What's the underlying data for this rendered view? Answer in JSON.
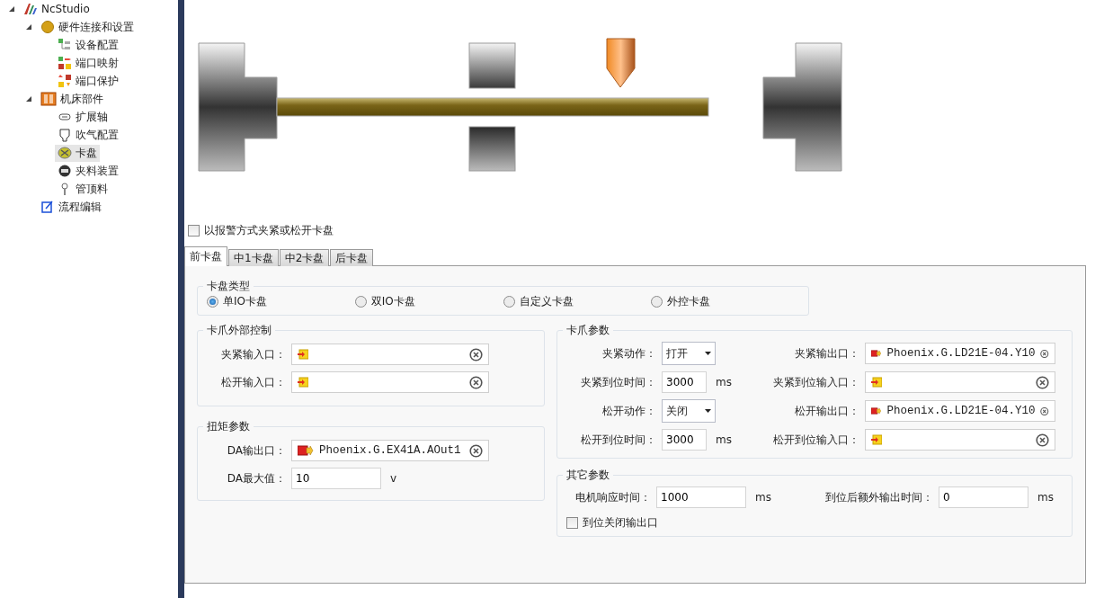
{
  "sidebar": {
    "tree": [
      {
        "label": "NcStudio",
        "expanded": true,
        "selected": false,
        "children": [
          {
            "label": "硬件连接和设置",
            "expanded": true,
            "selected": false,
            "children": [
              {
                "label": "设备配置",
                "selected": false
              },
              {
                "label": "端口映射",
                "selected": false
              },
              {
                "label": "端口保护",
                "selected": false
              }
            ]
          },
          {
            "label": "机床部件",
            "expanded": true,
            "selected": false,
            "children": [
              {
                "label": "扩展轴",
                "selected": false
              },
              {
                "label": "吹气配置",
                "selected": false
              },
              {
                "label": "卡盘",
                "selected": true
              },
              {
                "label": "夹料装置",
                "selected": false
              },
              {
                "label": "管顶料",
                "selected": false
              }
            ]
          },
          {
            "label": "流程编辑",
            "selected": false
          }
        ]
      }
    ]
  },
  "alarm_checkbox": {
    "label": "以报警方式夹紧或松开卡盘",
    "checked": false
  },
  "tabs": [
    {
      "label": "前卡盘",
      "selected": true
    },
    {
      "label": "中1卡盘",
      "selected": false
    },
    {
      "label": "中2卡盘",
      "selected": false
    },
    {
      "label": "后卡盘",
      "selected": false
    }
  ],
  "chuck_type": {
    "title": "卡盘类型",
    "options": [
      {
        "label": "单IO卡盘",
        "selected": true
      },
      {
        "label": "双IO卡盘",
        "selected": false
      },
      {
        "label": "自定义卡盘",
        "selected": false
      },
      {
        "label": "外控卡盘",
        "selected": false
      }
    ]
  },
  "external_control": {
    "title": "卡爪外部控制",
    "fields": [
      {
        "kind": "input_port",
        "label": "夹紧输入口："
      },
      {
        "kind": "input_port",
        "label": "松开输入口："
      }
    ]
  },
  "torque": {
    "title": "扭矩参数",
    "fields": [
      {
        "kind": "output_port",
        "label": "DA输出口：",
        "value": "Phoenix.G.EX41A.AOut1"
      },
      {
        "kind": "number",
        "label": "DA最大值：",
        "value": "10",
        "unit": "v"
      }
    ]
  },
  "claw_params": {
    "title": "卡爪参数",
    "fields": [
      {
        "kind": "select",
        "label": "夹紧动作：",
        "value": "打开"
      },
      {
        "kind": "output_port",
        "label": "夹紧输出口：",
        "value": "Phoenix.G.LD21E-04.Y10"
      },
      {
        "kind": "number",
        "label": "夹紧到位时间：",
        "value": "3000",
        "unit": "ms"
      },
      {
        "kind": "input_port",
        "label": "夹紧到位输入口："
      },
      {
        "kind": "select",
        "label": "松开动作：",
        "value": "关闭"
      },
      {
        "kind": "output_port",
        "label": "松开输出口：",
        "value": "Phoenix.G.LD21E-04.Y10"
      },
      {
        "kind": "number",
        "label": "松开到位时间：",
        "value": "3000",
        "unit": "ms"
      },
      {
        "kind": "input_port",
        "label": "松开到位输入口："
      }
    ]
  },
  "other_params": {
    "title": "其它参数",
    "fields": [
      {
        "kind": "number",
        "label": "电机响应时间：",
        "value": "1000",
        "unit": "ms"
      },
      {
        "kind": "number",
        "label": "到位后额外输出时间：",
        "value": "0",
        "unit": "ms"
      }
    ],
    "checkbox": {
      "label": "到位关闭输出口",
      "checked": false
    }
  }
}
